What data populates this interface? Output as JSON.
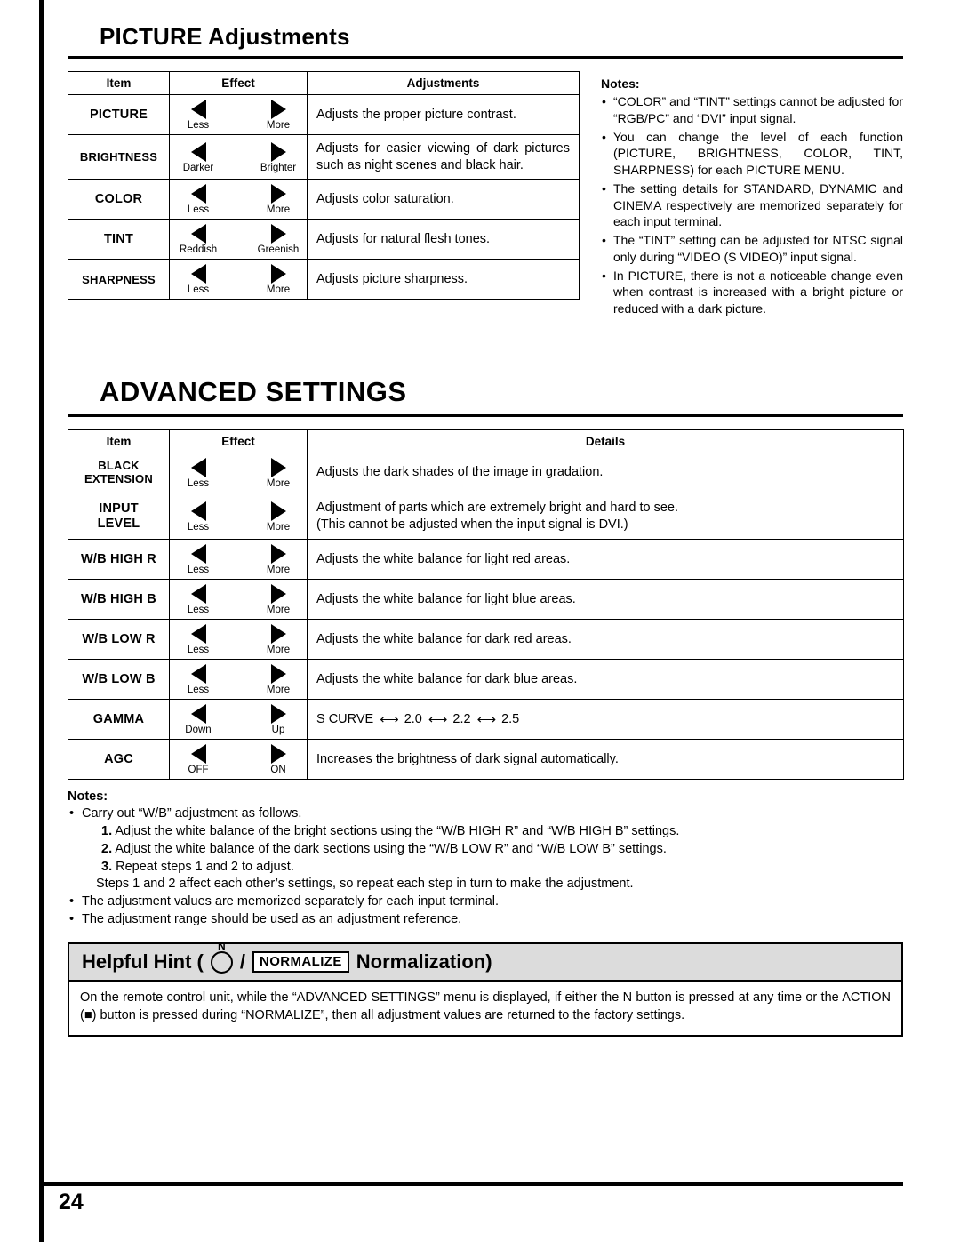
{
  "page_number": "24",
  "picture_section": {
    "title": "PICTURE Adjustments",
    "headers": [
      "Item",
      "Effect",
      "Adjustments"
    ],
    "rows": [
      {
        "item": "PICTURE",
        "left_label": "Less",
        "right_label": "More",
        "adjustment": "Adjusts the proper picture contrast."
      },
      {
        "item": "BRIGHTNESS",
        "left_label": "Darker",
        "right_label": "Brighter",
        "adjustment": "Adjusts for easier viewing of dark pictures such as night scenes and black hair."
      },
      {
        "item": "COLOR",
        "left_label": "Less",
        "right_label": "More",
        "adjustment": "Adjusts color saturation."
      },
      {
        "item": "TINT",
        "left_label": "Reddish",
        "right_label": "Greenish",
        "adjustment": "Adjusts for natural flesh tones."
      },
      {
        "item": "SHARPNESS",
        "left_label": "Less",
        "right_label": "More",
        "adjustment": "Adjusts picture sharpness."
      }
    ],
    "notes_title": "Notes:",
    "notes": [
      "“COLOR” and “TINT” settings cannot be adjusted for “RGB/PC” and “DVI” input signal.",
      "You can change the level of each function (PICTURE, BRIGHTNESS, COLOR, TINT, SHARPNESS) for each PICTURE MENU.",
      "The setting details for STANDARD, DYNAMIC and CINEMA respectively are memorized separately for each input terminal.",
      "The “TINT” setting can be adjusted for NTSC signal only during “VIDEO (S VIDEO)” input signal.",
      "In PICTURE, there is not a noticeable change even when contrast is increased with a bright picture or reduced with a dark picture."
    ]
  },
  "advanced_section": {
    "title": "ADVANCED SETTINGS",
    "headers": [
      "Item",
      "Effect",
      "Details"
    ],
    "rows": [
      {
        "item": "BLACK EXTENSION",
        "item_line1": "BLACK",
        "item_line2": "EXTENSION",
        "left_label": "Less",
        "right_label": "More",
        "details": "Adjusts the dark shades of the image in gradation."
      },
      {
        "item": "INPUT LEVEL",
        "item_line1": "INPUT",
        "item_line2": "LEVEL",
        "left_label": "Less",
        "right_label": "More",
        "details": "Adjustment of parts which are extremely bright and hard to see.",
        "details2": "(This cannot be adjusted when the input signal is DVI.)"
      },
      {
        "item": "W/B HIGH R",
        "left_label": "Less",
        "right_label": "More",
        "details": "Adjusts the white balance for light red areas."
      },
      {
        "item": "W/B HIGH B",
        "left_label": "Less",
        "right_label": "More",
        "details": "Adjusts the white balance for light blue areas."
      },
      {
        "item": "W/B LOW R",
        "left_label": "Less",
        "right_label": "More",
        "details": "Adjusts the white balance for dark red areas."
      },
      {
        "item": "W/B LOW B",
        "left_label": "Less",
        "right_label": "More",
        "details": "Adjusts the white balance for dark blue areas."
      },
      {
        "item": "GAMMA",
        "left_label": "Down",
        "right_label": "Up",
        "gamma_values": [
          "S CURVE",
          "2.0",
          "2.2",
          "2.5"
        ]
      },
      {
        "item": "AGC",
        "left_label": "OFF",
        "right_label": "ON",
        "details": "Increases the brightness of dark signal automatically."
      }
    ],
    "notes_title": "Notes:",
    "note_1": "Carry out “W/B” adjustment as follows.",
    "steps": [
      {
        "num": "1.",
        "text": "Adjust the white balance of the bright sections using the “W/B HIGH R” and “W/B HIGH B” settings."
      },
      {
        "num": "2.",
        "text": "Adjust the white balance of the dark sections using the “W/B LOW R” and “W/B LOW B” settings."
      },
      {
        "num": "3.",
        "text": "Repeat steps 1 and 2 to adjust."
      }
    ],
    "steps_note": "Steps 1 and 2 affect each other’s settings, so repeat each step in turn to make the adjustment.",
    "note_2": "The adjustment values are memorized separately for each input terminal.",
    "note_3": "The adjustment range should be used as an adjustment reference."
  },
  "helpful_hint": {
    "label_prefix": "Helpful Hint (",
    "n_letter": "N",
    "slash": "/",
    "normalize_tag": "NORMALIZE",
    "label_suffix": "Normalization)",
    "body": "On the remote control unit, while the “ADVANCED SETTINGS” menu is displayed, if either the N button is pressed at any time or the ACTION (■) button is pressed during “NORMALIZE”, then all adjustment values are returned to the factory settings."
  }
}
